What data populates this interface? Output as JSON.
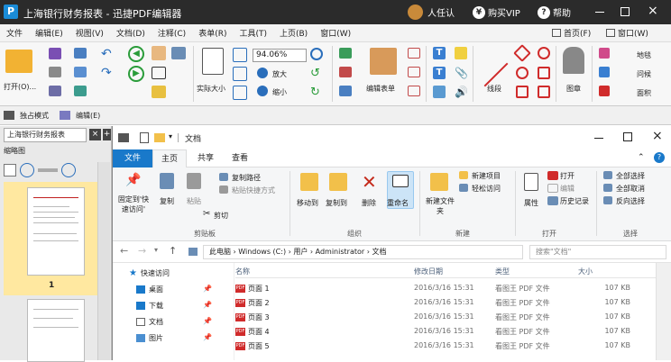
{
  "titlebar": {
    "app_icon_letter": "P",
    "title": "上海银行财务报表 - 迅捷PDF编辑器",
    "user_label": "人任认",
    "buy_label": "购买VIP",
    "help_label": "帮助"
  },
  "menu": {
    "items": [
      "文件",
      "编辑(E)",
      "视图(V)",
      "文档(D)",
      "注释(C)",
      "表单(R)",
      "工具(T)",
      "上页(B)",
      "窗口(W)"
    ],
    "first_page": "首页(F)",
    "window_list": "窗口(W)"
  },
  "ribbon": {
    "open_label": "打开(O)...",
    "zoom_value": "94.06%",
    "zoom_in": "放大",
    "zoom_out": "缩小",
    "actual_size": "实际大小",
    "edit_form": "编辑表单",
    "line_label": "线段",
    "stamp_label": "图章",
    "right1": "地毯",
    "right2": "问候",
    "right3": "面积"
  },
  "subtool": {
    "mode": "独占模式",
    "edit": "编辑(E)"
  },
  "thumbs": {
    "tab_label": "上海银行财务报表",
    "panel_label": "缩略图",
    "page_number": "1"
  },
  "explorer": {
    "window_title": "文档",
    "tabs": [
      "文件",
      "主页",
      "共享",
      "查看"
    ],
    "ribbon": {
      "pin_label": "固定到'快速访问'",
      "copy_label": "复制",
      "paste_label": "粘贴",
      "copy_path": "复制路径",
      "paste_shortcut": "粘贴快捷方式",
      "cut_label": "剪切",
      "move_to": "移动到",
      "copy_to": "复制到",
      "delete_label": "删除",
      "rename_label": "重命名",
      "new_folder": "新建文件夹",
      "new_item": "新建项目",
      "easy_access": "轻松访问",
      "properties": "属性",
      "open_label": "打开",
      "edit_label": "编辑",
      "history": "历史记录",
      "select_all": "全部选择",
      "select_none": "全部取消",
      "invert": "反向选择",
      "groups": [
        "剪贴板",
        "组织",
        "新建",
        "打开",
        "选择"
      ]
    },
    "address": {
      "crumbs": "此电脑 › Windows (C:) › 用户 › Administrator › 文档",
      "search_placeholder": "搜索\"文档\""
    },
    "nav": [
      "快速访问",
      "桌面",
      "下载",
      "文档",
      "图片"
    ],
    "columns": [
      "名称",
      "修改日期",
      "类型",
      "大小"
    ],
    "files": [
      {
        "name": "页面 1",
        "date": "2016/3/16 15:31",
        "type": "看图王 PDF 文件",
        "size": "107 KB"
      },
      {
        "name": "页面 2",
        "date": "2016/3/16 15:31",
        "type": "看图王 PDF 文件",
        "size": "107 KB"
      },
      {
        "name": "页面 3",
        "date": "2016/3/16 15:31",
        "type": "看图王 PDF 文件",
        "size": "107 KB"
      },
      {
        "name": "页面 4",
        "date": "2016/3/16 15:31",
        "type": "看图王 PDF 文件",
        "size": "107 KB"
      },
      {
        "name": "页面 5",
        "date": "2016/3/16 15:31",
        "type": "看图王 PDF 文件",
        "size": "107 KB"
      }
    ]
  }
}
